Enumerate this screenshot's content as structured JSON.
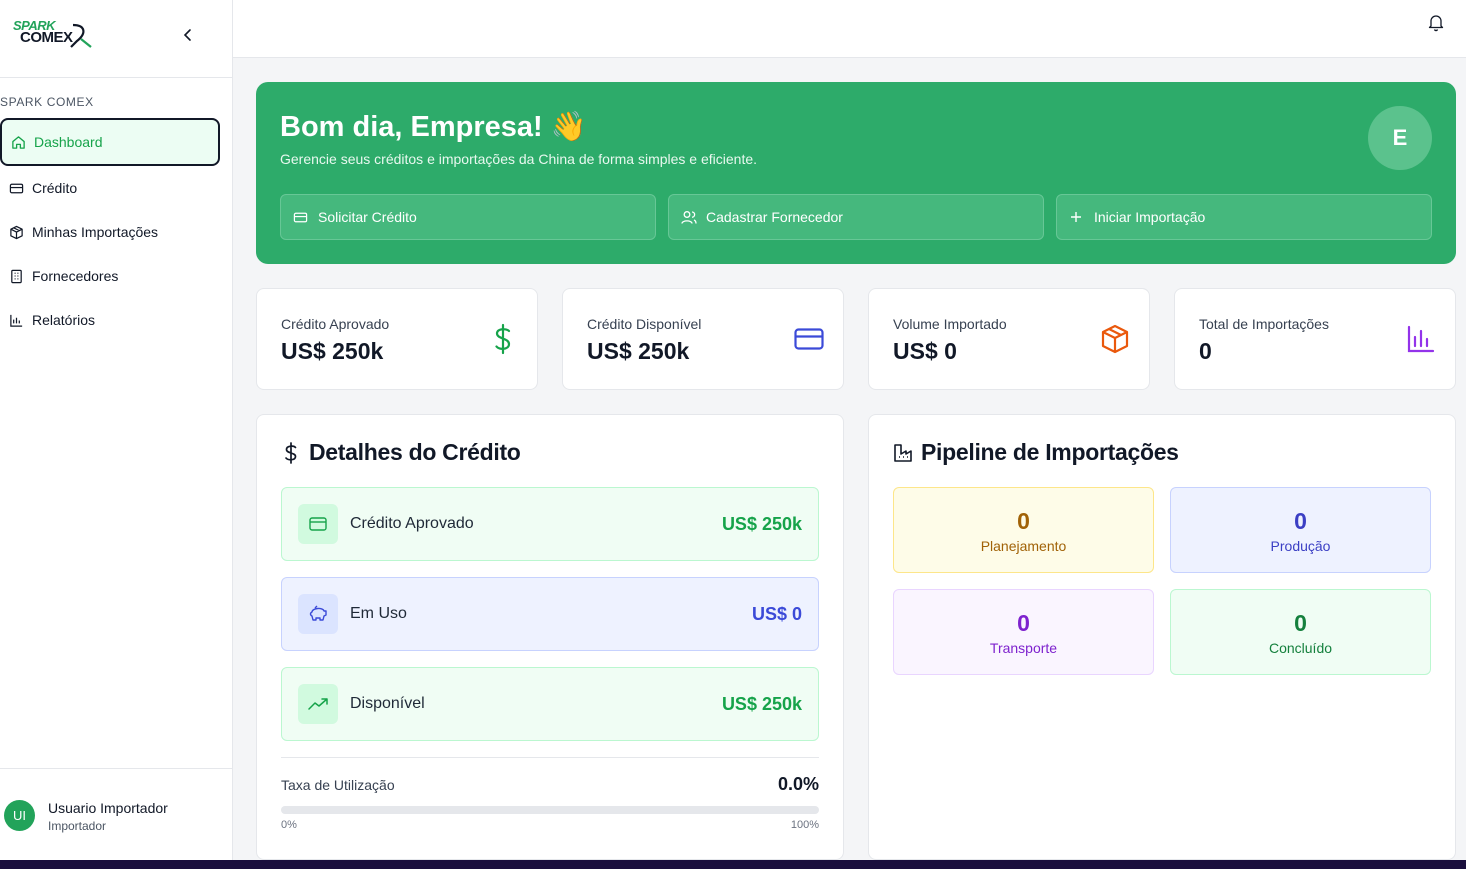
{
  "brand": {
    "line1": "SPARK",
    "line2": "COMEX"
  },
  "sidebar": {
    "section": "SPARK COMEX",
    "items": [
      {
        "label": "Dashboard",
        "icon": "home-icon",
        "active": true
      },
      {
        "label": "Crédito",
        "icon": "credit-card-icon"
      },
      {
        "label": "Minhas Importações",
        "icon": "package-icon"
      },
      {
        "label": "Fornecedores",
        "icon": "building-icon"
      },
      {
        "label": "Relatórios",
        "icon": "bar-chart-icon"
      }
    ],
    "user": {
      "initials": "UI",
      "name": "Usuario Importador",
      "role": "Importador"
    }
  },
  "hero": {
    "title": "Bom dia, Empresa! 👋",
    "subtitle": "Gerencie seus créditos e importações da China de forma simples e eficiente.",
    "avatar": "E",
    "buttons": [
      {
        "label": "Solicitar Crédito",
        "icon": "credit-card-icon"
      },
      {
        "label": "Cadastrar Fornecedor",
        "icon": "users-icon"
      },
      {
        "label": "Iniciar Importação",
        "icon": "plus-icon"
      }
    ]
  },
  "stats": [
    {
      "label": "Crédito Aprovado",
      "value": "US$ 250k",
      "icon": "dollar-icon",
      "color": "#16a34a"
    },
    {
      "label": "Crédito Disponível",
      "value": "US$ 250k",
      "icon": "credit-card-icon",
      "color": "#3b4ad8"
    },
    {
      "label": "Volume Importado",
      "value": "US$ 0",
      "icon": "package-icon",
      "color": "#ea580c"
    },
    {
      "label": "Total de Importações",
      "value": "0",
      "icon": "bar-chart-icon",
      "color": "#9333ea"
    }
  ],
  "credit": {
    "title": "Detalhes do Crédito",
    "rows": [
      {
        "label": "Crédito Aprovado",
        "value": "US$ 250k",
        "icon": "credit-card-icon"
      },
      {
        "label": "Em Uso",
        "value": "US$ 0",
        "icon": "piggy-bank-icon"
      },
      {
        "label": "Disponível",
        "value": "US$ 250k",
        "icon": "trending-up-icon"
      }
    ],
    "utilization": {
      "label": "Taxa de Utilização",
      "value": "0.0%",
      "fraction": 0.0,
      "min": "0%",
      "max": "100%"
    }
  },
  "pipeline": {
    "title": "Pipeline de Importações",
    "stages": [
      {
        "count": "0",
        "label": "Planejamento"
      },
      {
        "count": "0",
        "label": "Produção"
      },
      {
        "count": "0",
        "label": "Transporte"
      },
      {
        "count": "0",
        "label": "Concluído"
      }
    ]
  }
}
